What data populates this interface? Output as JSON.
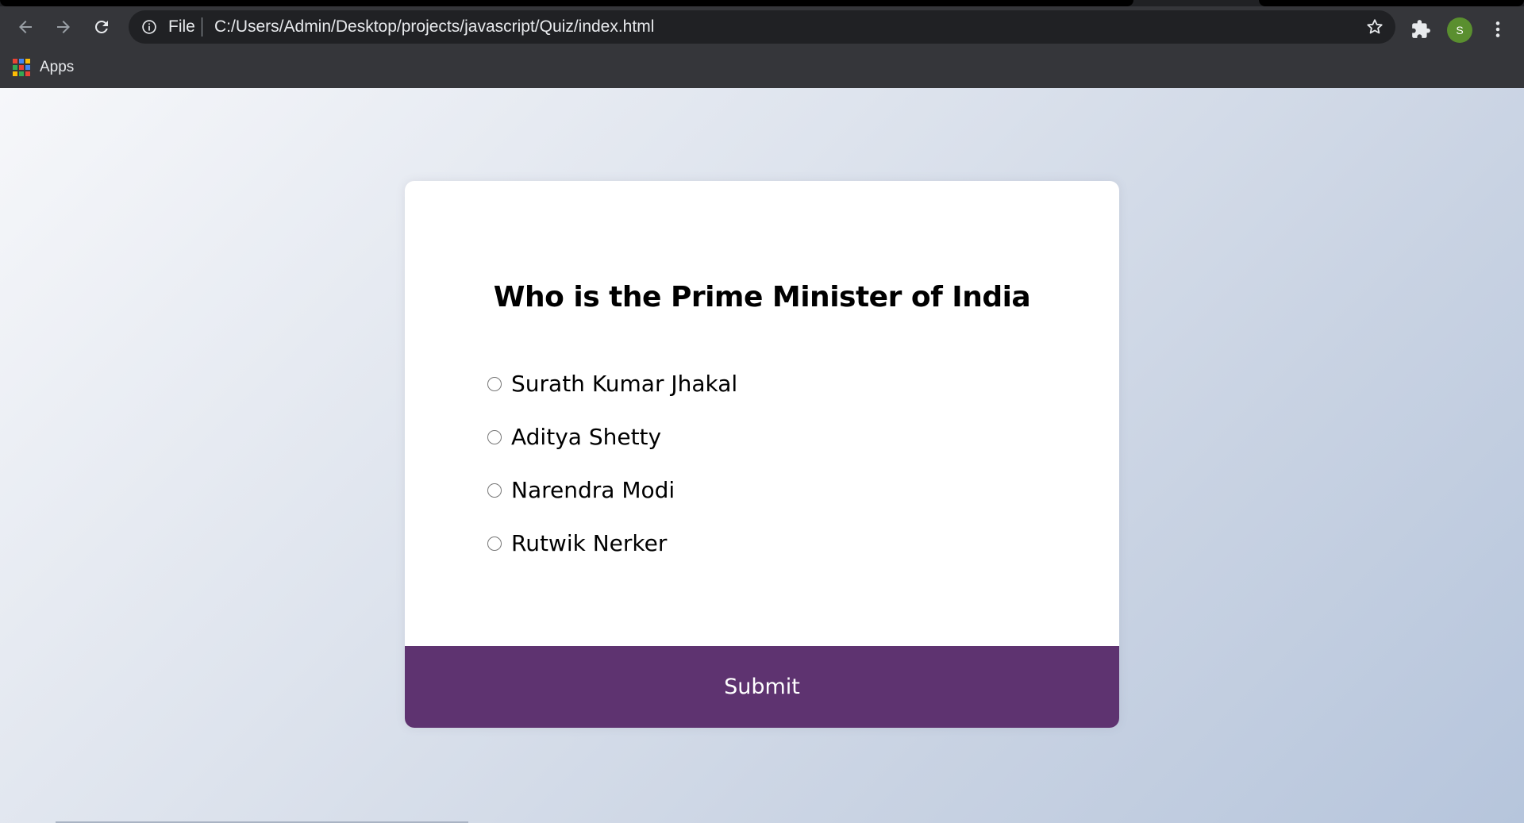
{
  "browser": {
    "omnibox": {
      "scheme_label": "File",
      "url": "C:/Users/Admin/Desktop/projects/javascript/Quiz/index.html"
    },
    "profile_initial": "S",
    "bookmarks": [
      {
        "label": "Apps"
      }
    ],
    "colors": {
      "chrome_bg": "#35363a",
      "omnibox_bg": "#202124",
      "avatar_bg": "#5a8f2f"
    }
  },
  "quiz": {
    "question": "Who is the Prime Minister of India",
    "answers": [
      {
        "label": "Surath Kumar Jhakal",
        "selected": false
      },
      {
        "label": "Aditya Shetty",
        "selected": false
      },
      {
        "label": "Narendra Modi",
        "selected": false
      },
      {
        "label": "Rutwik Nerker",
        "selected": false
      }
    ],
    "submit_label": "Submit",
    "colors": {
      "submit_bg": "#5e3370",
      "card_bg": "#ffffff"
    }
  }
}
